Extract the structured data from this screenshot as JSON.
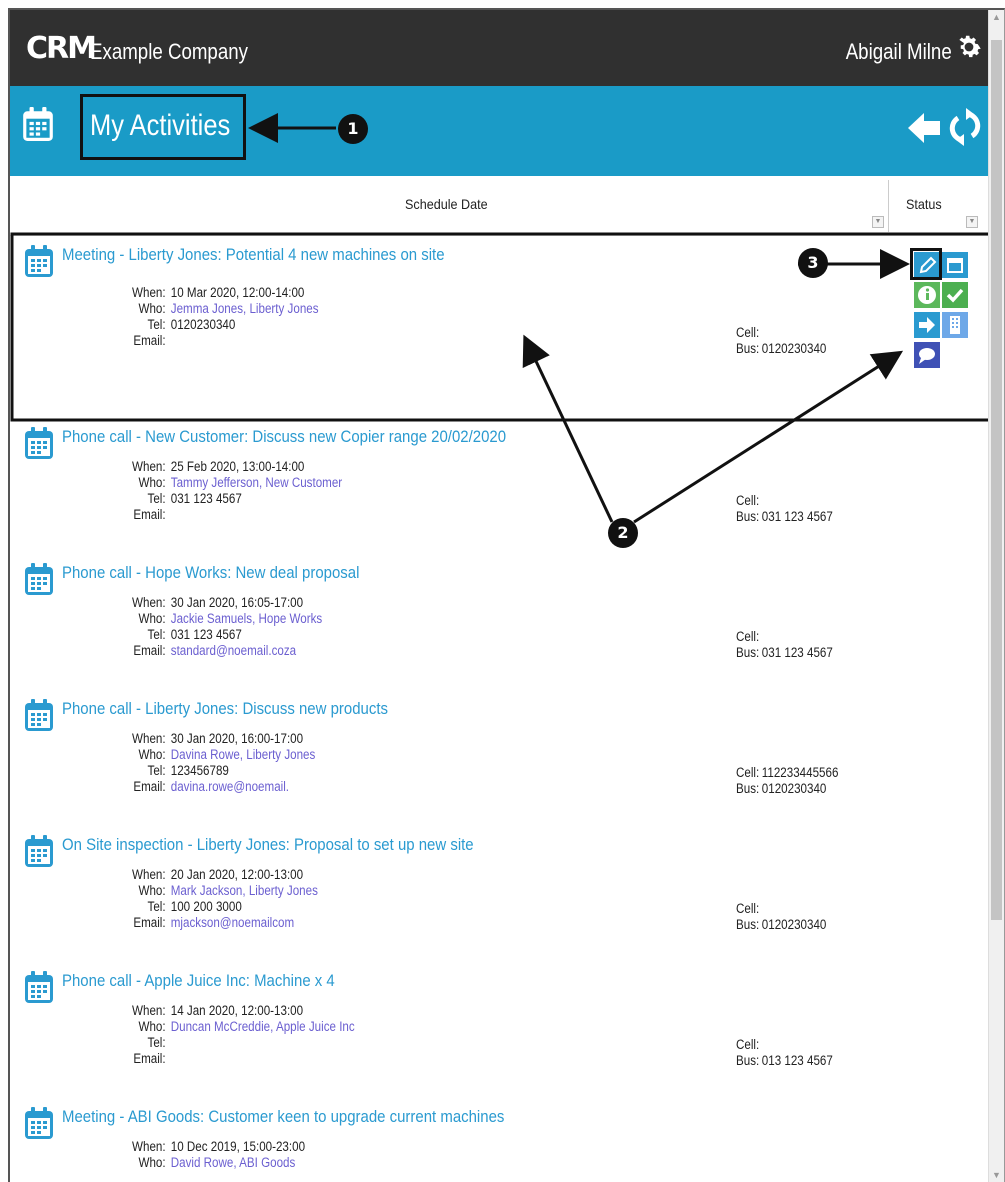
{
  "header": {
    "logo_text": "CRM",
    "company": "Example Company",
    "user": "Abigail Milne"
  },
  "titlebar": {
    "title": "My Activities"
  },
  "columns": {
    "schedule_date": "Schedule Date",
    "status": "Status"
  },
  "labels": {
    "when": "When:",
    "who": "Who:",
    "tel": "Tel:",
    "email": "Email:",
    "cell": "Cell:",
    "bus": "Bus:"
  },
  "activities": [
    {
      "title": "Meeting - Liberty Jones: Potential 4 new machines on site",
      "when": "10 Mar 2020, 12:00-14:00",
      "who": "Jemma Jones, Liberty Jones",
      "tel": "0120230340",
      "email": "",
      "cell": "",
      "bus": "0120230340"
    },
    {
      "title": "Phone call - New Customer: Discuss new Copier range 20/02/2020",
      "when": "25 Feb 2020, 13:00-14:00",
      "who": "Tammy Jefferson, New Customer",
      "tel": "031 123 4567",
      "email": "",
      "cell": "",
      "bus": "031 123 4567"
    },
    {
      "title": "Phone call - Hope Works: New deal proposal",
      "when": "30 Jan 2020, 16:05-17:00",
      "who": "Jackie Samuels, Hope Works",
      "tel": "031 123 4567",
      "email": "standard@noemail.coza",
      "cell": "",
      "bus": "031 123 4567"
    },
    {
      "title": "Phone call - Liberty Jones: Discuss new products",
      "when": "30 Jan 2020, 16:00-17:00",
      "who": "Davina Rowe, Liberty Jones",
      "tel": "123456789",
      "email": "davina.rowe@noemail.",
      "cell": "112233445566",
      "bus": "0120230340"
    },
    {
      "title": "On Site inspection - Liberty Jones: Proposal to set up new site",
      "when": "20 Jan 2020, 12:00-13:00",
      "who": "Mark Jackson, Liberty Jones",
      "tel": "100 200 3000",
      "email": "mjackson@noemailcom",
      "cell": "",
      "bus": "0120230340"
    },
    {
      "title": "Phone call - Apple Juice Inc: Machine x 4",
      "when": "14 Jan 2020, 12:00-13:00",
      "who": "Duncan McCreddie, Apple Juice Inc",
      "tel": "",
      "email": "",
      "cell": "",
      "bus": "013 123 4567"
    },
    {
      "title": "Meeting - ABI Goods: Customer keen to upgrade current machines",
      "when": "10 Dec 2019, 15:00-23:00",
      "who": "David Rowe, ABI Goods",
      "tel": "",
      "email": "",
      "cell": "",
      "bus": ""
    }
  ],
  "callouts": {
    "one": "1",
    "two": "2",
    "three": "3"
  },
  "colors": {
    "topbar": "#303030",
    "titlebar": "#1a9bc7",
    "link": "#2a9ad0",
    "person": "#6b5fd0"
  }
}
